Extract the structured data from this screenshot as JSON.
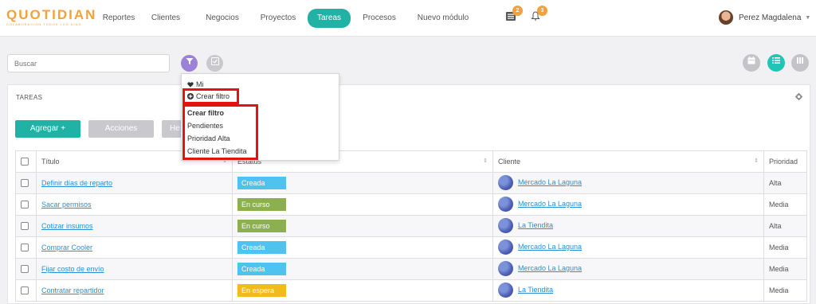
{
  "app": {
    "logo_text": "QUOTIDIAN",
    "logo_tagline": "COLABORACIÓN TODOS LOS DÍAS"
  },
  "nav": {
    "items": [
      "Reportes",
      "Clientes",
      "Negocios",
      "Proyectos",
      "Tareas",
      "Procesos",
      "Nuevo módulo"
    ],
    "active": "Tareas"
  },
  "toolbar": {
    "tasks_badge": "2",
    "notifications_badge": "3"
  },
  "user": {
    "name": "Perez Magdalena"
  },
  "search": {
    "placeholder": "Buscar"
  },
  "panel": {
    "title": "TAREAS",
    "add_label": "Agregar +",
    "actions_label": "Acciones",
    "hidden_label": "He"
  },
  "dropdown": {
    "favorite": "Mi",
    "create_link": "Crear filtro",
    "section_title": "Crear filtro",
    "filters": [
      "Pendientes",
      "Prioridad Alta",
      "Cliente La Tiendita"
    ]
  },
  "table": {
    "headers": {
      "title": "Título",
      "status": "Estatus",
      "client": "Cliente",
      "priority": "Prioridad"
    },
    "rows": [
      {
        "title": "Definir días de reparto",
        "status": "Creada",
        "client": "Mercado La Laguna",
        "priority": "Alta"
      },
      {
        "title": "Sacar permisos",
        "status": "En curso",
        "client": "Mercado La Laguna",
        "priority": "Media"
      },
      {
        "title": "Cotizar insumos",
        "status": "En curso",
        "client": "La Tiendita",
        "priority": "Alta"
      },
      {
        "title": "Comprar Cooler",
        "status": "Creada",
        "client": "Mercado La Laguna",
        "priority": "Media"
      },
      {
        "title": "Fijar costo de envío",
        "status": "Creada",
        "client": "Mercado La Laguna",
        "priority": "Media"
      },
      {
        "title": "Contratar repartidor",
        "status": "En espera",
        "client": "La Tiendita",
        "priority": "Media"
      }
    ]
  },
  "colors": {
    "accent": "#21b2a6",
    "filter_button": "#9b82d6",
    "status_creada": "#4fc3f0",
    "status_en_curso": "#8cb04f",
    "status_en_espera": "#f2bb1d",
    "badge": "#f2a23b",
    "highlight": "#e21313"
  },
  "icons": [
    "filter-icon",
    "check-icon",
    "calendar-icon",
    "list-icon",
    "columns-icon",
    "tasks-icon",
    "bell-icon",
    "gear-icon",
    "heart-icon",
    "plus-circle-icon"
  ]
}
